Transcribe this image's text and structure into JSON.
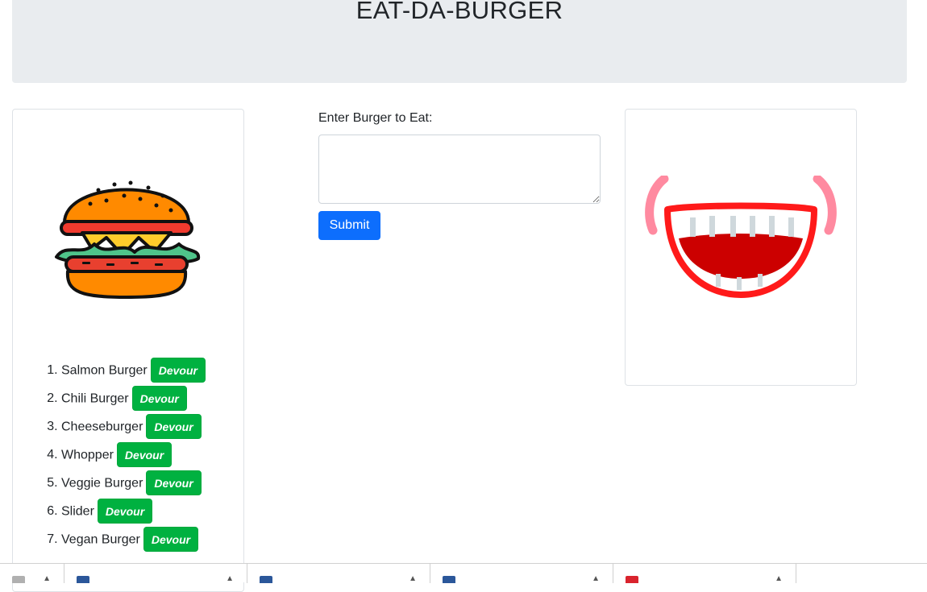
{
  "header": {
    "title": "EAT-DA-BURGER"
  },
  "burgers": [
    {
      "number": "1.",
      "name": "Salmon Burger"
    },
    {
      "number": "2.",
      "name": "Chili Burger"
    },
    {
      "number": "3.",
      "name": "Cheeseburger"
    },
    {
      "number": "4.",
      "name": "Whopper"
    },
    {
      "number": "5.",
      "name": "Veggie Burger"
    },
    {
      "number": "6.",
      "name": "Slider"
    },
    {
      "number": "7.",
      "name": "Vegan Burger"
    }
  ],
  "devour_label": "Devour",
  "form": {
    "label": "Enter Burger to Eat:",
    "value": "",
    "submit_label": "Submit"
  },
  "images": {
    "left": "burger-illustration",
    "right": "smiling-mouth-illustration"
  },
  "taskbar": {
    "items": [
      {
        "icon": "document-icon",
        "label": ""
      },
      {
        "icon": "word-doc-icon",
        "label": ""
      },
      {
        "icon": "word-doc-icon",
        "label": ""
      },
      {
        "icon": "word-doc-icon",
        "label": ""
      },
      {
        "icon": "pdf-icon",
        "label": ""
      }
    ]
  },
  "colors": {
    "devour": "#00b140",
    "submit": "#0d6efd",
    "jumbotron": "#e9ecef"
  }
}
